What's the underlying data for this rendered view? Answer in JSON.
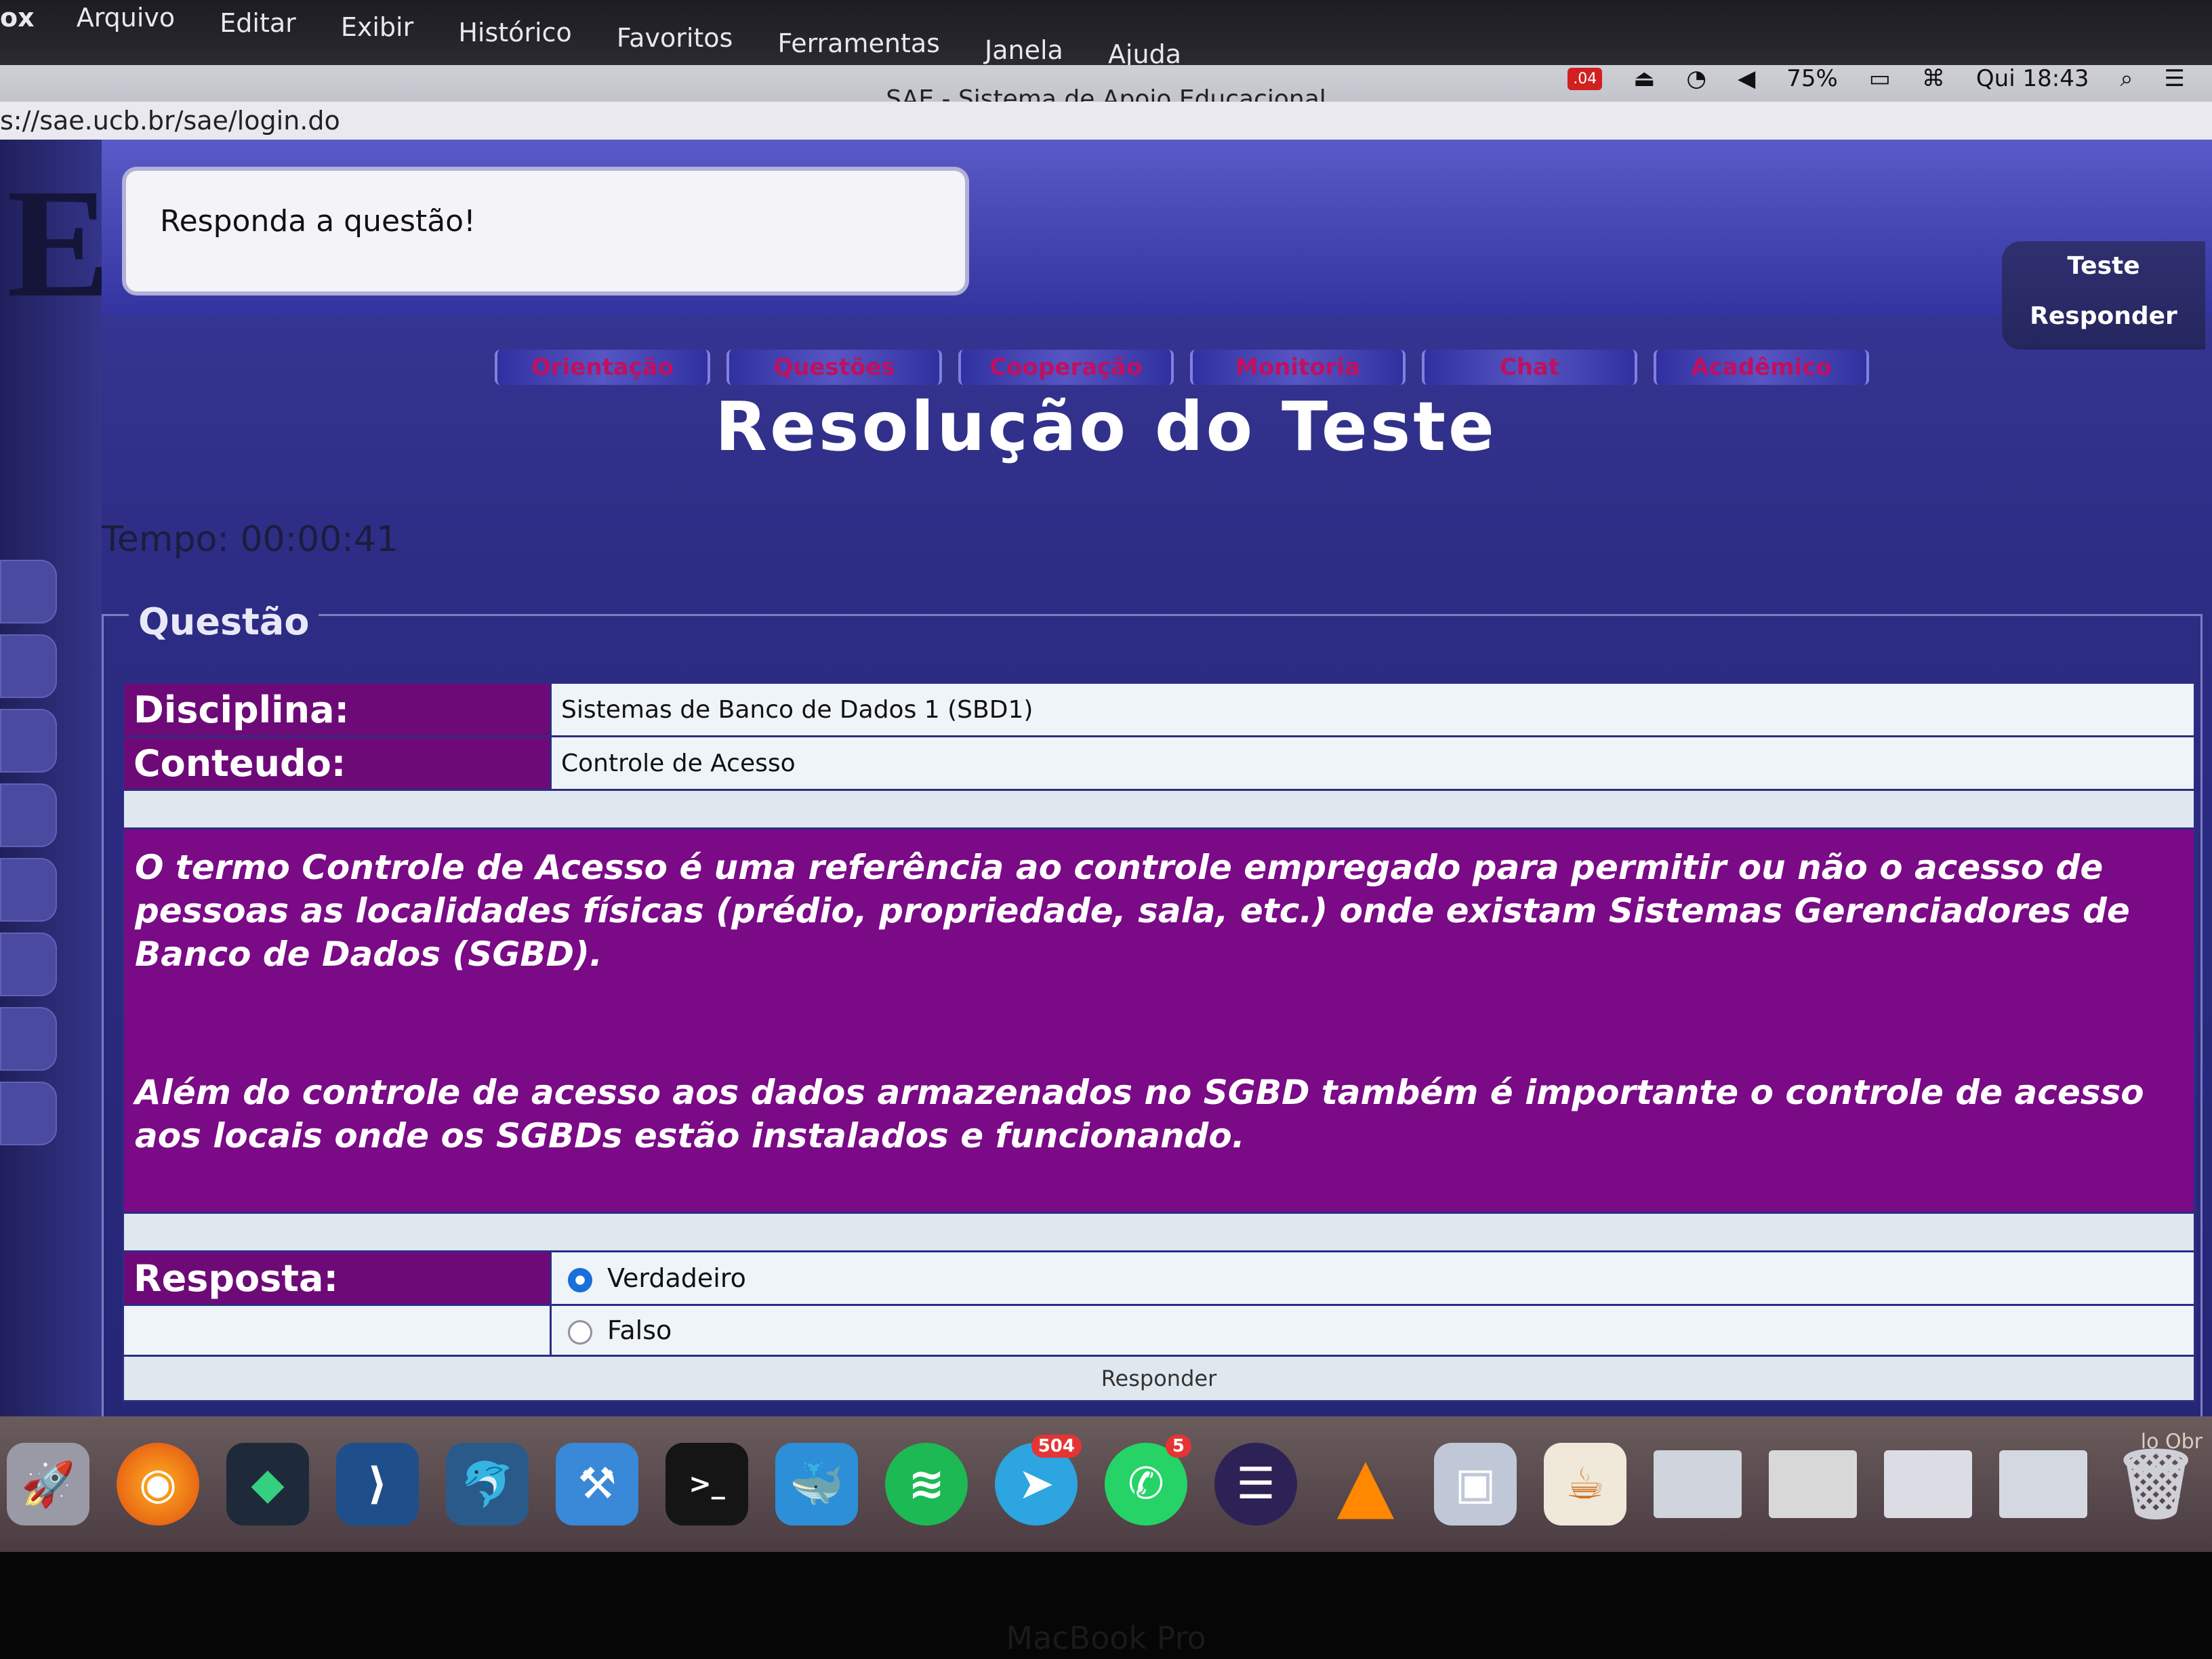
{
  "menubar": {
    "app": "ox",
    "items": [
      "Arquivo",
      "Editar",
      "Exibir",
      "Histórico",
      "Favoritos",
      "Ferramentas",
      "Janela",
      "Ajuda"
    ],
    "battery": "75%",
    "clock": "Qui 18:43",
    "notification_badge": ".04"
  },
  "browser": {
    "window_title": "SAE - Sistema de Apoio Educacional",
    "url": "s://sae.ucb.br/sae/login.do",
    "toolbar_icons": [
      "more-icon",
      "pocket-icon",
      "bookmark-star-icon",
      "hamburger-menu-icon"
    ]
  },
  "page": {
    "message": "Responda a questão!",
    "side_box": {
      "line1": "Teste",
      "line2": "Responder"
    },
    "tabs": [
      "Orientação",
      "Questões",
      "Cooperação",
      "Monitoria",
      "Chat",
      "Acadêmico"
    ],
    "title": "Resolução do Teste",
    "timer": "Tempo: 00:00:41",
    "legend": "Questão",
    "discipline_label": "Disciplina:",
    "discipline_value": "Sistemas de Banco de Dados 1 (SBD1)",
    "content_label": "Conteudo:",
    "content_value": "Controle de Acesso",
    "question_p1": "O termo Controle de Acesso é uma referência ao controle empregado para permitir ou não o acesso de pessoas as localidades físicas (prédio, propriedade, sala, etc.) onde existam Sistemas Gerenciadores de Banco de Dados (SGBD).",
    "question_p2": "Além do controle de acesso aos dados armazenados no SGBD também é importante o controle de acesso aos locais onde os SGBDs estão instalados e funcionando.",
    "answer_label": "Resposta:",
    "options": [
      {
        "label": "Verdadeiro",
        "selected": true
      },
      {
        "label": "Falso",
        "selected": false
      }
    ],
    "submit": "Responder"
  },
  "dock": {
    "apps": [
      {
        "name": "launchpad-icon",
        "badge": ""
      },
      {
        "name": "firefox-icon",
        "badge": ""
      },
      {
        "name": "sourcetree-icon",
        "badge": ""
      },
      {
        "name": "vscode-icon",
        "badge": ""
      },
      {
        "name": "mysql-workbench-icon",
        "badge": ""
      },
      {
        "name": "xcode-icon",
        "badge": ""
      },
      {
        "name": "terminal-icon",
        "badge": ""
      },
      {
        "name": "docker-icon",
        "badge": ""
      },
      {
        "name": "spotify-icon",
        "badge": ""
      },
      {
        "name": "telegram-icon",
        "badge": "504"
      },
      {
        "name": "whatsapp-icon",
        "badge": "5"
      },
      {
        "name": "eclipse-icon",
        "badge": ""
      },
      {
        "name": "vlc-icon",
        "badge": ""
      },
      {
        "name": "preview-icon",
        "badge": ""
      },
      {
        "name": "java-icon",
        "badge": ""
      },
      {
        "name": "window-thumbnail-1-icon",
        "badge": ""
      },
      {
        "name": "window-thumbnail-2-icon",
        "badge": ""
      },
      {
        "name": "window-thumbnail-3-icon",
        "badge": ""
      },
      {
        "name": "window-thumbnail-4-icon",
        "badge": ""
      },
      {
        "name": "trash-icon",
        "badge": ""
      }
    ],
    "label": "lo Obr"
  },
  "bezel": {
    "label": "MacBook Pro"
  },
  "colors": {
    "page_blue": "#2c2c84",
    "label_purple": "#6e0a78",
    "question_purple": "#7a0a86",
    "tab_text": "#c01060"
  }
}
